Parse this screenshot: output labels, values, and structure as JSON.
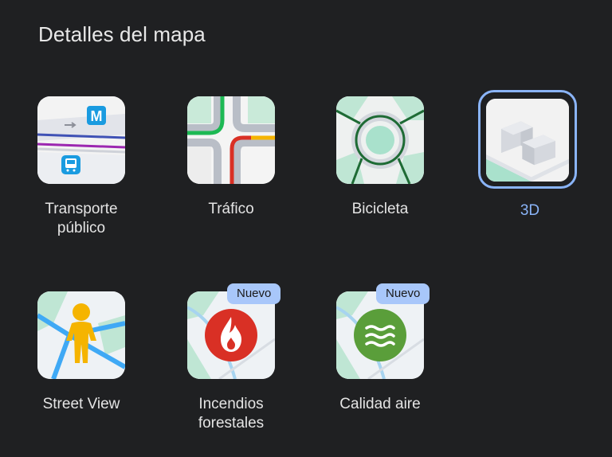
{
  "header": {
    "title": "Detalles del mapa"
  },
  "tiles": [
    {
      "label": "Transporte\npúblico",
      "icon": "transit-icon",
      "selected": false
    },
    {
      "label": "Tráfico",
      "icon": "traffic-icon",
      "selected": false
    },
    {
      "label": "Bicicleta",
      "icon": "bicycle-icon",
      "selected": false
    },
    {
      "label": "3D",
      "icon": "3d-buildings-icon",
      "selected": true
    },
    {
      "label": "Street View",
      "icon": "pegman-icon",
      "selected": false
    },
    {
      "label": "Incendios\nforestales",
      "icon": "fire-icon",
      "selected": false,
      "badge": "Nuevo"
    },
    {
      "label": "Calidad aire",
      "icon": "air-quality-icon",
      "selected": false,
      "badge": "Nuevo"
    }
  ],
  "transit_badge": "M",
  "colors": {
    "background": "#1f2022",
    "selected": "#8ab4f8",
    "badge": "#a8c7fa",
    "traffic_green": "#1db954",
    "traffic_red": "#d93025",
    "fire_red": "#d93025",
    "air_green": "#5a9e3a"
  }
}
